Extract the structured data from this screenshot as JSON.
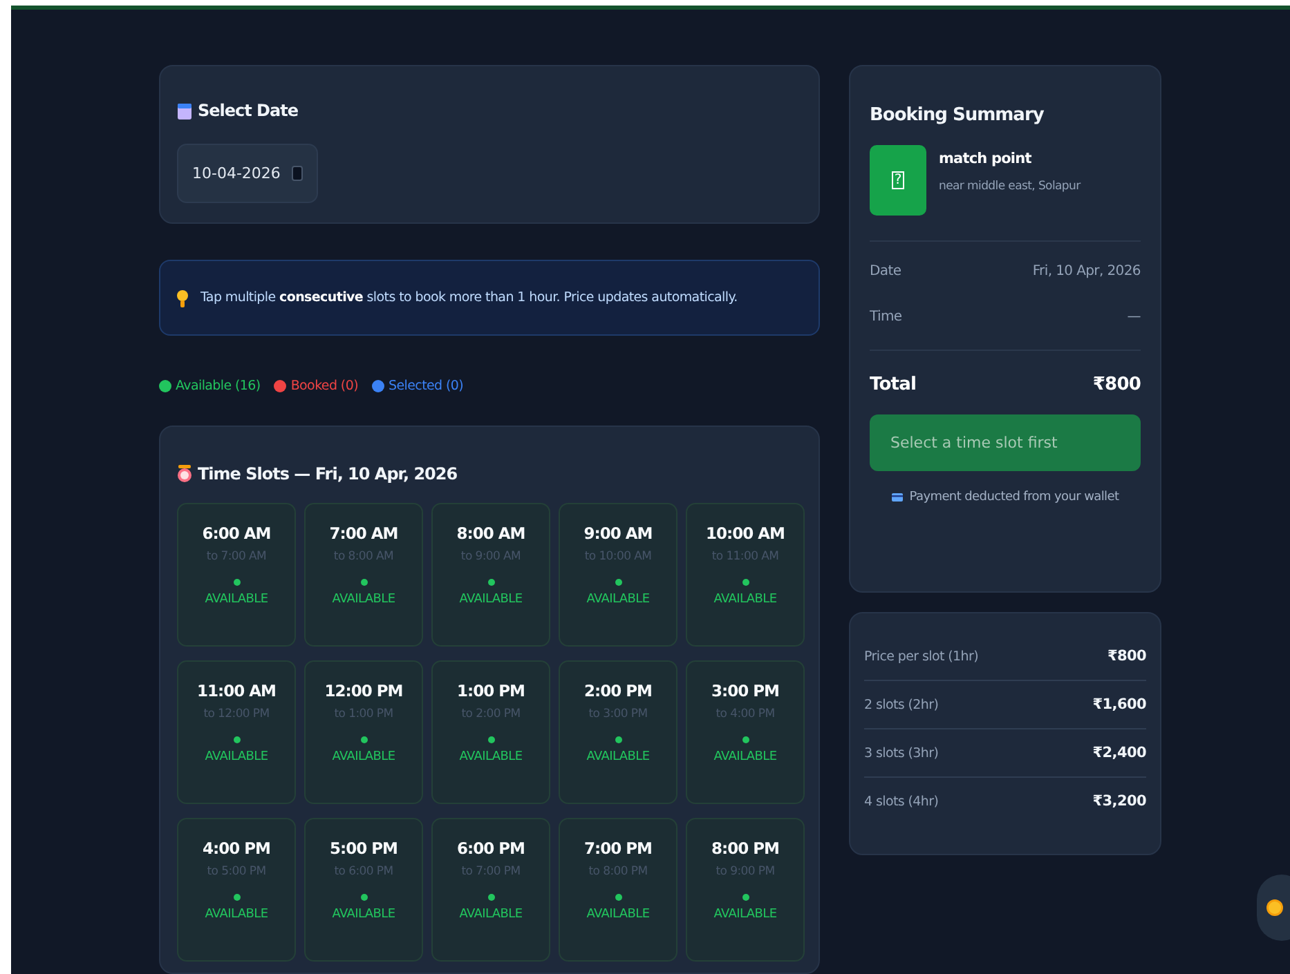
{
  "date_card": {
    "title": "Select Date",
    "date_value": "10-04-2026"
  },
  "tip": {
    "text": "Tap multiple **consecutive** slots to book more than 1 hour. Price updates automatically."
  },
  "legend": [
    {
      "label": "Available (16)",
      "color": "#22c55e"
    },
    {
      "label": "Booked (0)",
      "color": "#ef4444"
    },
    {
      "label": "Selected (0)",
      "color": "#3b82f6"
    }
  ],
  "slots_card": {
    "title": "Time Slots — Fri, 10 Apr, 2026",
    "slots": [
      {
        "time": "6:00 AM",
        "until": "to 7:00 AM",
        "kind": "available",
        "status_label": "AVAILABLE"
      },
      {
        "time": "7:00 AM",
        "until": "to 8:00 AM",
        "kind": "available",
        "status_label": "AVAILABLE"
      },
      {
        "time": "8:00 AM",
        "until": "to 9:00 AM",
        "kind": "available",
        "status_label": "AVAILABLE"
      },
      {
        "time": "9:00 AM",
        "until": "to 10:00 AM",
        "kind": "available",
        "status_label": "AVAILABLE"
      },
      {
        "time": "10:00 AM",
        "until": "to 11:00 AM",
        "kind": "available",
        "status_label": "AVAILABLE"
      },
      {
        "time": "11:00 AM",
        "until": "to 12:00 PM",
        "kind": "available",
        "status_label": "AVAILABLE"
      },
      {
        "time": "12:00 PM",
        "until": "to 1:00 PM",
        "kind": "available",
        "status_label": "AVAILABLE"
      },
      {
        "time": "1:00 PM",
        "until": "to 2:00 PM",
        "kind": "available",
        "status_label": "AVAILABLE"
      },
      {
        "time": "2:00 PM",
        "until": "to 3:00 PM",
        "kind": "available",
        "status_label": "AVAILABLE"
      },
      {
        "time": "3:00 PM",
        "until": "to 4:00 PM",
        "kind": "available",
        "status_label": "AVAILABLE"
      },
      {
        "time": "4:00 PM",
        "until": "to 5:00 PM",
        "kind": "available",
        "status_label": "AVAILABLE"
      },
      {
        "time": "5:00 PM",
        "until": "to 6:00 PM",
        "kind": "available",
        "status_label": "AVAILABLE"
      },
      {
        "time": "6:00 PM",
        "until": "to 7:00 PM",
        "kind": "available",
        "status_label": "AVAILABLE"
      },
      {
        "time": "7:00 PM",
        "until": "to 8:00 PM",
        "kind": "available",
        "status_label": "AVAILABLE"
      },
      {
        "time": "8:00 PM",
        "until": "to 9:00 PM",
        "kind": "available",
        "status_label": "AVAILABLE"
      }
    ]
  },
  "summary": {
    "title": "Booking Summary",
    "venue_glyph": "?",
    "venue_name": "match point",
    "venue_address": "near middle east, Solapur",
    "rows": [
      {
        "label": "Date",
        "value": "Fri, 10 Apr, 2026"
      },
      {
        "label": "Time",
        "value": "—"
      }
    ],
    "total_label": "Total",
    "total_value": "₹800",
    "button": {
      "label": "Select a time slot first",
      "disabled": true
    },
    "note": "Payment deducted from your wallet"
  },
  "prices": [
    {
      "label": "Price per slot (1hr)",
      "value": "₹800"
    },
    {
      "label": "2 slots (2hr)",
      "value": "₹1,600"
    },
    {
      "label": "3 slots (3hr)",
      "value": "₹2,400"
    },
    {
      "label": "4 slots (4hr)",
      "value": "₹3,200"
    }
  ]
}
